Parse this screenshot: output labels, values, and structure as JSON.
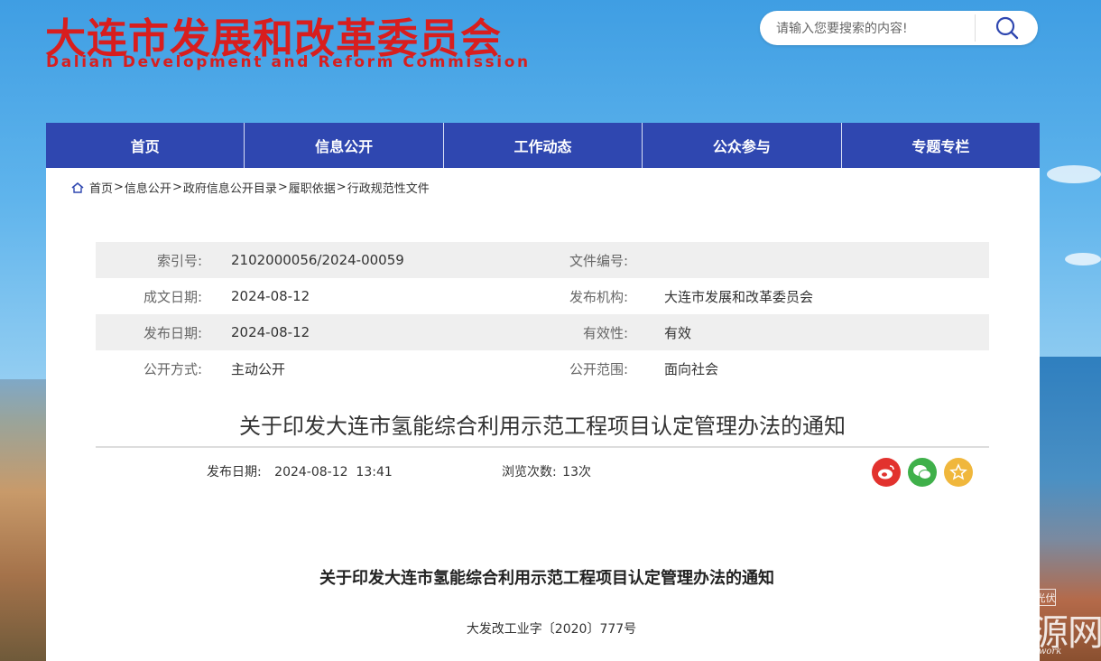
{
  "header": {
    "logo_cn": "大连市发展和改革委员会",
    "logo_en": "Dalian Development and Reform Commission"
  },
  "search": {
    "placeholder": "请输入您要搜索的内容!",
    "icon": "search-icon"
  },
  "nav": {
    "items": [
      "首页",
      "信息公开",
      "工作动态",
      "公众参与",
      "专题专栏"
    ]
  },
  "breadcrumb": {
    "icon": "home-icon",
    "items": [
      "首页",
      "信息公开",
      "政府信息公开目录",
      "履职依据",
      "行政规范性文件"
    ],
    "separator": ">"
  },
  "meta": {
    "rows": [
      {
        "label1": "索引号:",
        "value1": "2102000056/2024-00059",
        "label2": "文件编号:",
        "value2": ""
      },
      {
        "label1": "成文日期:",
        "value1": "2024-08-12",
        "label2": "发布机构:",
        "value2": "大连市发展和改革委员会"
      },
      {
        "label1": "发布日期:",
        "value1": "2024-08-12",
        "label2": "有效性:",
        "value2": "有效"
      },
      {
        "label1": "公开方式:",
        "value1": "主动公开",
        "label2": "公开范围:",
        "value2": "面向社会"
      }
    ]
  },
  "article": {
    "title": "关于印发大连市氢能综合利用示范工程项目认定管理办法的通知",
    "publish_label": "发布日期:",
    "publish_value": "2024-08-12  13:41",
    "views_label": "浏览次数:",
    "views_value": "13次",
    "body_title": "关于印发大连市氢能综合利用示范工程项目认定管理办法的通知",
    "doc_number": "大发改工业字〔2020〕777号"
  },
  "share": {
    "icons": [
      "weibo-icon",
      "wechat-icon",
      "favorite-star-icon"
    ],
    "colors": [
      "#e2322e",
      "#3fb04a",
      "#f0b73c"
    ]
  },
  "watermark": {
    "small": "投资关注新能源汽车与光伏",
    "big": "世纪新能源网",
    "en": "Century new energy network"
  },
  "colors": {
    "brand_red": "#d81e1e",
    "nav_blue": "#2f47b0"
  }
}
